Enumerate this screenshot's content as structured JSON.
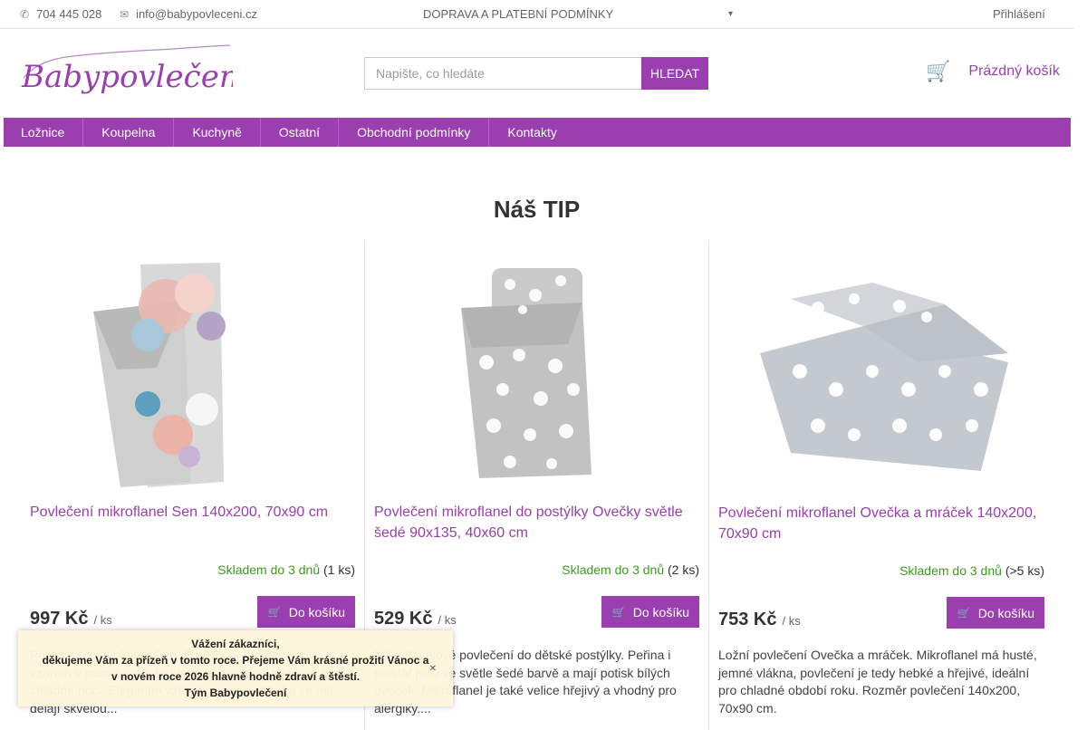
{
  "topbar": {
    "phone_icon": "phone-icon",
    "phone": "704 445 028",
    "mail_icon": "mail-icon",
    "email": "info@babypovleceni.cz",
    "shipping_link": "DOPRAVA A PLATEBNÍ PODMÍNKY",
    "login": "Přihlášení"
  },
  "header": {
    "logo_text": "Babypovlečení",
    "search_placeholder": "Napište, co hledáte",
    "search_button": "HLEDAT",
    "cart_icon": "cart-icon",
    "cart_label": "Prázdný košík"
  },
  "nav": {
    "items": [
      "Ložnice",
      "Koupelna",
      "Kuchyně",
      "Ostatní",
      "Obchodní podmínky",
      "Kontakty"
    ]
  },
  "section_title": "Náš TIP",
  "products": [
    {
      "name": "Povlečení mikroflanel Sen 140x200, 70x90 cm",
      "stock": "Skladem do 3 dnů",
      "qty": "(1 ks)",
      "price": "997 Kč",
      "unit": "/ ks",
      "button": "Do košíku",
      "description": "Povlečení mikroflanel Sen. Povlečení s květinovým vzorem v pastelových barvách je příjemné a hřejivé pro chladné noci. Elegantní vzhled a jemná výšivka ze něj dělají skvělou..."
    },
    {
      "name": "Povlečení mikroflanel do postýlky Ovečky světle šedé 90x135, 40x60 cm",
      "stock": "Skladem do 3 dnů",
      "qty": "(2 ks)",
      "price": "529 Kč",
      "unit": "/ ks",
      "button": "Do košíku",
      "description": "Mikroflanelové povlečení do dětské postýlky. Peřina i polštář jsou ve světle šedé barvě a mají potisk bílých oveček. Mikroflanel je také velice hřejivý a vhodný pro alergiky...."
    },
    {
      "name": "Povlečení mikroflanel Ovečka a mráček 140x200, 70x90 cm",
      "stock": "Skladem do 3 dnů",
      "qty": "(>5 ks)",
      "price": "753 Kč",
      "unit": "/ ks",
      "button": "Do košíku",
      "description": "Ložní povlečení Ovečka a mráček. Mikroflanel má husté, jemné vlákna, povlečení je tedy hebké a hřejivé, ideální pro chladné období roku. Rozměr povlečení 140x200, 70x90 cm."
    }
  ],
  "notice": {
    "line1": "Vážení zákazníci,",
    "line2": "děkujeme Vám za přízeň v tomto roce. Přejeme Vám krásné prožití Vánoc a",
    "line3": "v novém roce 2026 hlavně hodně zdraví a štěstí.",
    "line4": "Tým Babypovlečení"
  },
  "colors": {
    "brand": "#9a3eb0",
    "stock_green": "#3c9a1c",
    "notice_bg": "#fef6db"
  }
}
